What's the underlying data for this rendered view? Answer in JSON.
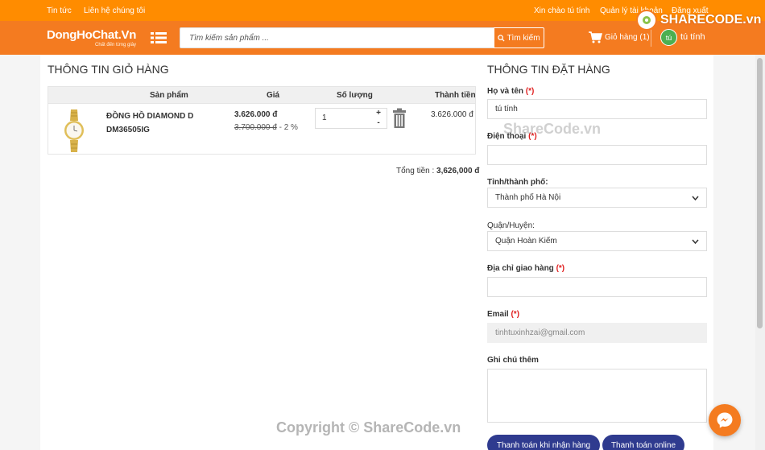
{
  "topbar": {
    "news": "Tin tức",
    "contact": "Liên hệ chúng tôi",
    "greeting": "Xin chào tú tính",
    "account": "Quản lý tài khoản",
    "logout": "Đăng xuất"
  },
  "header": {
    "logo": "DongHoChat.Vn",
    "tagline": "Chất đến từng giây",
    "search_placeholder": "Tìm kiếm sản phẩm ...",
    "search_button": "Tìm kiếm",
    "cart_label": "Giỏ hàng (1)",
    "avatar_initials": "tú",
    "username": "tú tính"
  },
  "watermark": {
    "logo_text": "SHARECODE.vn",
    "center": "ShareCode.vn",
    "bottom": "Copyright © ShareCode.vn"
  },
  "cart": {
    "title": "THÔNG TIN GIỎ HÀNG",
    "columns": {
      "product": "Sản phẩm",
      "price": "Giá",
      "quantity": "Số lượng",
      "subtotal": "Thành tiền"
    },
    "items": [
      {
        "name": "ĐỒNG HỒ DIAMOND D DM36505IG",
        "price": "3.626.000 đ",
        "old_price": "3.700.000 đ",
        "discount": " - 2 %",
        "quantity": "1",
        "subtotal": "3.626.000 đ"
      }
    ],
    "total_label": "Tổng tiền : ",
    "total_value": "3,626,000 đ"
  },
  "order": {
    "title": "THÔNG TIN ĐẶT HÀNG",
    "name_label": "Họ và tên ",
    "name_value": "tú tính",
    "phone_label": "Điện thoại ",
    "phone_value": "",
    "city_label": "Tỉnh/thành phố:",
    "city_value": "Thành phố Hà Nội",
    "district_label": "Quận/Huyện:",
    "district_value": "Quận Hoàn Kiếm",
    "address_label": "Địa chỉ giao hàng ",
    "address_value": "",
    "email_label": "Email ",
    "email_value": "tinhtuxinhzai@gmail.com",
    "note_label": "Ghi chú thêm",
    "required_mark": "(*)",
    "cod_button": "Thanh toán khi nhận hàng",
    "online_button": "Thanh toán online"
  },
  "colors": {
    "brand": "#f47b20",
    "button": "#2f3b8f",
    "required": "#e02020"
  }
}
